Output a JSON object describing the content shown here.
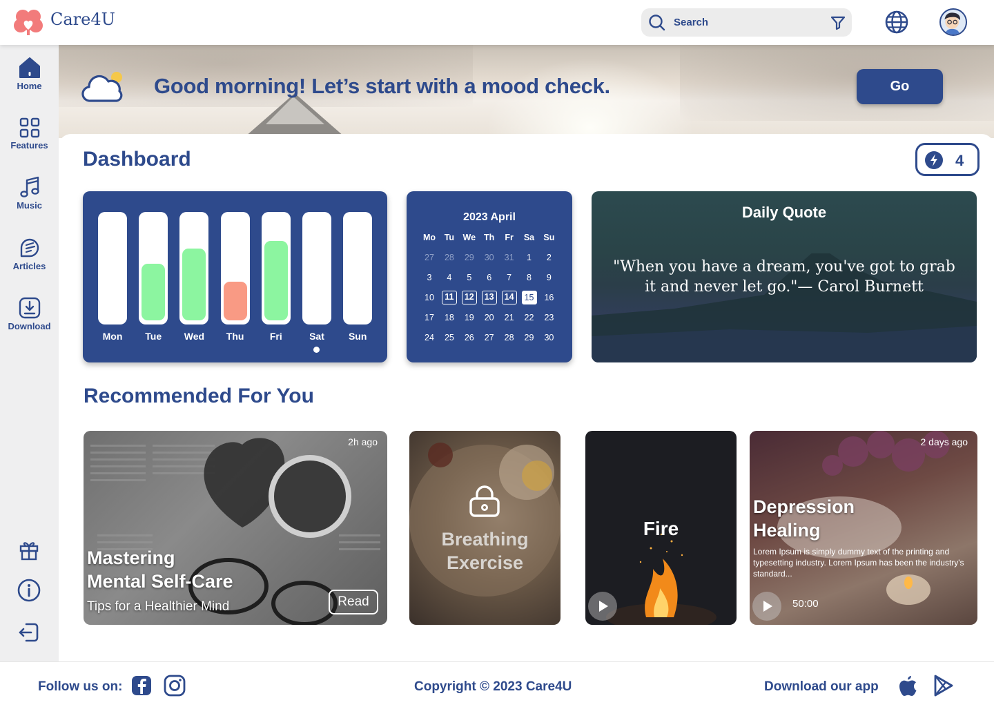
{
  "app": {
    "name": "Care4U"
  },
  "header": {
    "search_placeholder": "Search"
  },
  "sidebar": {
    "items": [
      {
        "label": "Home",
        "icon": "home-icon"
      },
      {
        "label": "Features",
        "icon": "grid-icon"
      },
      {
        "label": "Music",
        "icon": "music-note-icon"
      },
      {
        "label": "Articles",
        "icon": "article-icon"
      },
      {
        "label": "Download",
        "icon": "download-icon"
      }
    ],
    "bottom_icons": [
      "gift-icon",
      "info-icon",
      "logout-icon"
    ]
  },
  "banner": {
    "greeting": "Good morning! Let’s start with a mood check.",
    "button": "Go"
  },
  "dashboard": {
    "title": "Dashboard",
    "streak": "4",
    "mood_week": {
      "days": [
        "Mon",
        "Tue",
        "Wed",
        "Thu",
        "Fri",
        "Sat",
        "Sun"
      ],
      "levels": [
        0,
        0.54,
        0.69,
        0.37,
        0.76,
        0,
        0
      ],
      "moods": [
        "none",
        "good",
        "good",
        "bad",
        "good",
        "none",
        "none"
      ],
      "current_day": "Sat"
    },
    "calendar": {
      "title": "2023 April",
      "weekdays": [
        "Mo",
        "Tu",
        "We",
        "Th",
        "Fr",
        "Sa",
        "Su"
      ],
      "weeks": [
        [
          "27",
          "28",
          "29",
          "30",
          "31",
          "1",
          "2"
        ],
        [
          "3",
          "4",
          "5",
          "6",
          "7",
          "8",
          "9"
        ],
        [
          "10",
          "11",
          "12",
          "13",
          "14",
          "15",
          "16"
        ],
        [
          "17",
          "18",
          "19",
          "20",
          "21",
          "22",
          "23"
        ],
        [
          "24",
          "25",
          "26",
          "27",
          "28",
          "29",
          "30"
        ]
      ],
      "checked_days": [
        "11",
        "12",
        "13",
        "14"
      ],
      "today": "15"
    },
    "quote": {
      "title": "Daily Quote",
      "text": "\"When you have a dream, you've got to grab it and never let go.\"— Carol Burnett"
    }
  },
  "recommended": {
    "title": "Recommended For You",
    "cards": [
      {
        "title_line1": "Mastering",
        "title_line2": "Mental Self-Care",
        "subtitle": "Tips for a Healthier Mind",
        "time": "2h ago",
        "button": "Read"
      },
      {
        "title_line1": "Breathing",
        "title_line2": "Exercise",
        "locked": true
      },
      {
        "title": "Fire"
      },
      {
        "title_line1": "Depression",
        "title_line2": "Healing",
        "time": "2 days ago",
        "description": "Lorem Ipsum is simply dummy text of the printing and typesetting industry. Lorem Ipsum has been the industry's standard...",
        "duration": "50:00"
      }
    ]
  },
  "footer": {
    "follow": "Follow us on:",
    "copyright": "Copyright © 2023 Care4U",
    "download": "Download our app"
  },
  "colors": {
    "primary": "#2e4a8c",
    "good": "#8cf5a0",
    "bad": "#f99a84",
    "sidebar": "#efeff0"
  }
}
